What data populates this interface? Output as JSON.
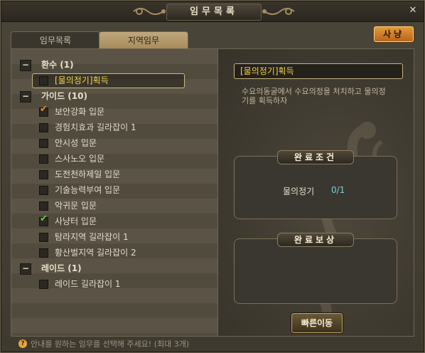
{
  "window": {
    "title": "임무목록",
    "close_glyph": "✕"
  },
  "tabs": [
    {
      "label": "임무목록",
      "active": false
    },
    {
      "label": "지역임무",
      "active": true
    }
  ],
  "close_button": {
    "label": "사냥"
  },
  "quest_list": {
    "groups": [
      {
        "label": "환수 (1)",
        "items": [
          {
            "label": "[물의정기]획득",
            "checked": false,
            "selected": true
          }
        ]
      },
      {
        "label": "가이드 (10)",
        "items": [
          {
            "label": "보안강화 입문",
            "checked": true,
            "check_color": "#f08a2c"
          },
          {
            "label": "경험치효과 길라잡이 1",
            "checked": false
          },
          {
            "label": "안시성 입문",
            "checked": false
          },
          {
            "label": "스사노오 입문",
            "checked": false
          },
          {
            "label": "도전천하제일 입문",
            "checked": false
          },
          {
            "label": "기술능력부여 입문",
            "checked": false
          },
          {
            "label": "악귀문 입문",
            "checked": false
          },
          {
            "label": "사냥터 입문",
            "checked": true,
            "check_color": "#5fd23a"
          },
          {
            "label": "탐라지역 길라잡이 1",
            "checked": false
          },
          {
            "label": "황산벌지역 길라잡이 2",
            "checked": false
          }
        ]
      },
      {
        "label": "레이드 (1)",
        "items": [
          {
            "label": "레이드 길라잡이 1",
            "checked": false
          }
        ]
      }
    ]
  },
  "detail": {
    "title": "[물의정기]획득",
    "description": "수요의동굴에서 수요의정을 처치하고 물의정기를 획득하자",
    "completion_condition": {
      "label": "완료조건",
      "item_name": "물의정기",
      "progress": "0/1"
    },
    "completion_reward": {
      "label": "완료보상"
    },
    "move_button": {
      "label": "빠른이동"
    }
  },
  "footer": {
    "icon": "?",
    "text": "안내를 원하는 임무를 선택해 주세요! (최대 3개)"
  },
  "colors": {
    "accent_orange": "#e29a3c",
    "selected_text": "#f2d04a",
    "progress_text": "#78d0e2"
  }
}
